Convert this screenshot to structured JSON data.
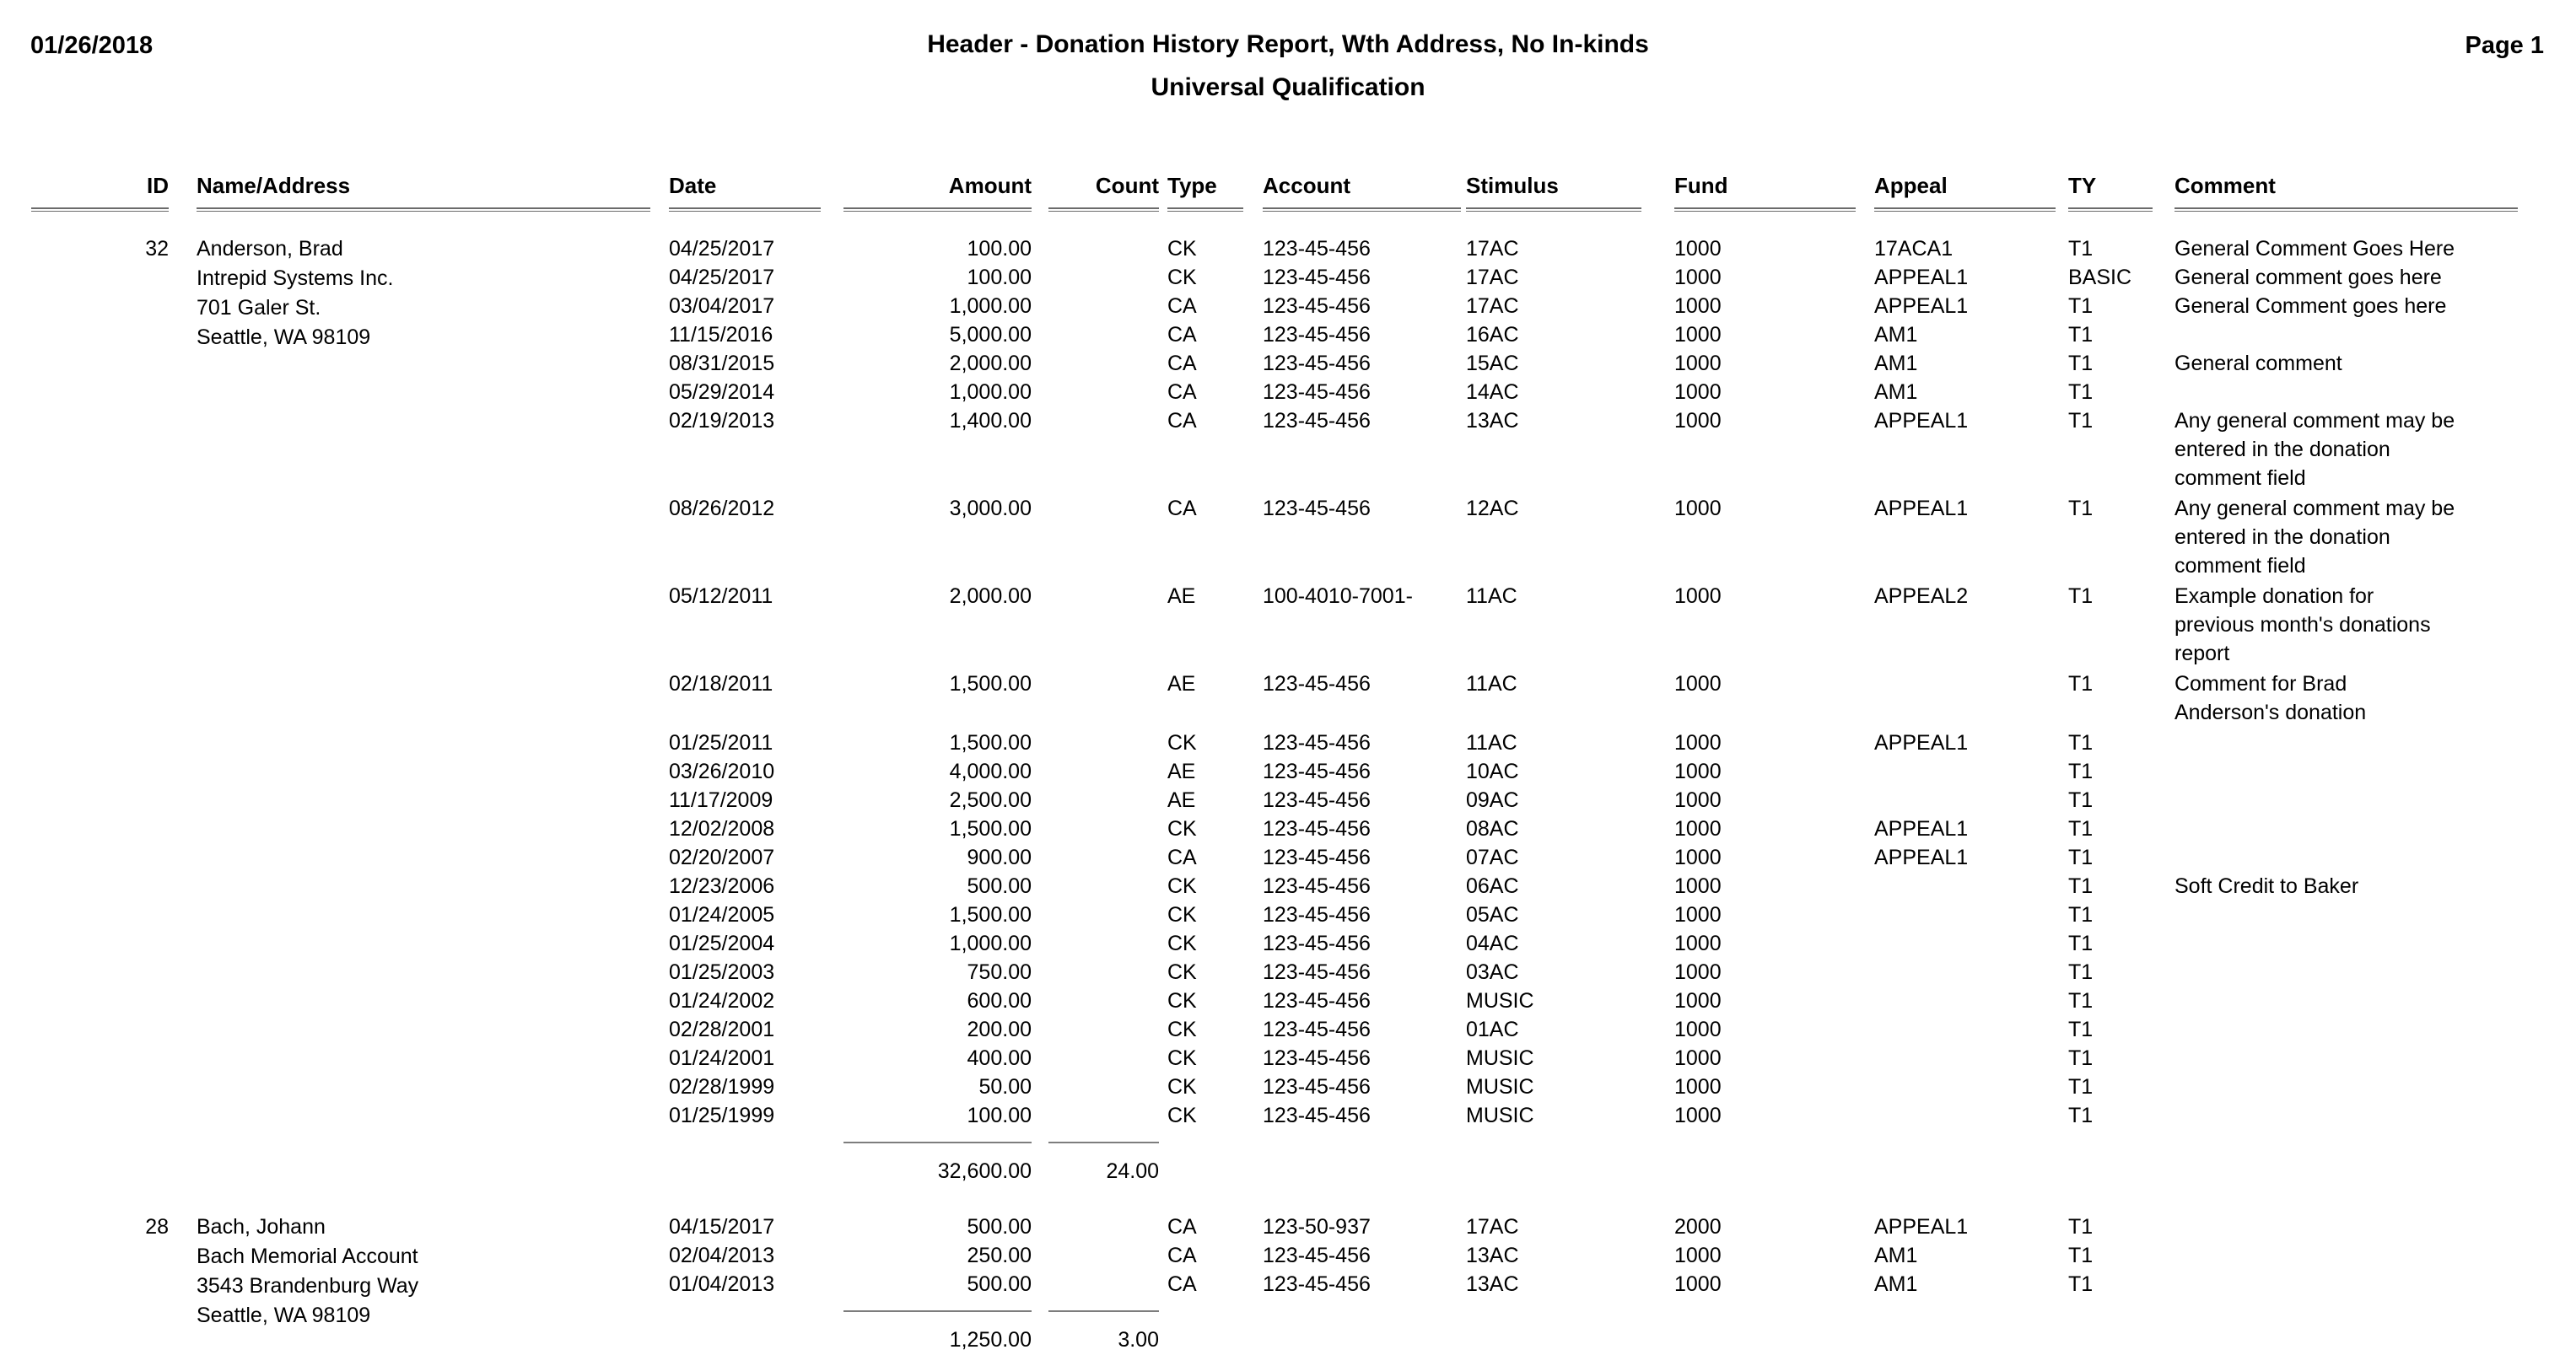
{
  "header": {
    "date": "01/26/2018",
    "title": "Header - Donation History Report, Wth Address, No In-kinds",
    "subtitle": "Universal Qualification",
    "page_label": "Page 1"
  },
  "columns": {
    "id": "ID",
    "name_address": "Name/Address",
    "date": "Date",
    "amount": "Amount",
    "count": "Count",
    "type": "Type",
    "account": "Account",
    "stimulus": "Stimulus",
    "fund": "Fund",
    "appeal": "Appeal",
    "ty": "TY",
    "comment": "Comment"
  },
  "records": [
    {
      "id": "32",
      "name_address": [
        "Anderson, Brad",
        "Intrepid Systems Inc.",
        "701 Galer St.",
        "Seattle, WA 98109"
      ],
      "donations": [
        {
          "date": "04/25/2017",
          "amount": "100.00",
          "type": "CK",
          "account": "123-45-456",
          "stimulus": "17AC",
          "fund": "1000",
          "appeal": "17ACA1",
          "ty": "T1",
          "comment": "General Comment Goes Here"
        },
        {
          "date": "04/25/2017",
          "amount": "100.00",
          "type": "CK",
          "account": "123-45-456",
          "stimulus": "17AC",
          "fund": "1000",
          "appeal": "APPEAL1",
          "ty": "BASIC",
          "comment": "General comment goes here"
        },
        {
          "date": "03/04/2017",
          "amount": "1,000.00",
          "type": "CA",
          "account": "123-45-456",
          "stimulus": "17AC",
          "fund": "1000",
          "appeal": "APPEAL1",
          "ty": "T1",
          "comment": "General Comment goes here"
        },
        {
          "date": "11/15/2016",
          "amount": "5,000.00",
          "type": "CA",
          "account": "123-45-456",
          "stimulus": "16AC",
          "fund": "1000",
          "appeal": "AM1",
          "ty": "T1",
          "comment": ""
        },
        {
          "date": "08/31/2015",
          "amount": "2,000.00",
          "type": "CA",
          "account": "123-45-456",
          "stimulus": "15AC",
          "fund": "1000",
          "appeal": "AM1",
          "ty": "T1",
          "comment": "General comment"
        },
        {
          "date": "05/29/2014",
          "amount": "1,000.00",
          "type": "CA",
          "account": "123-45-456",
          "stimulus": "14AC",
          "fund": "1000",
          "appeal": "AM1",
          "ty": "T1",
          "comment": ""
        },
        {
          "date": "02/19/2013",
          "amount": "1,400.00",
          "type": "CA",
          "account": "123-45-456",
          "stimulus": "13AC",
          "fund": "1000",
          "appeal": "APPEAL1",
          "ty": "T1",
          "comment": "Any general comment may be entered in the donation comment field"
        },
        {
          "date": "08/26/2012",
          "amount": "3,000.00",
          "type": "CA",
          "account": "123-45-456",
          "stimulus": "12AC",
          "fund": "1000",
          "appeal": "APPEAL1",
          "ty": "T1",
          "comment": "Any general comment may be entered in the donation comment field"
        },
        {
          "date": "05/12/2011",
          "amount": "2,000.00",
          "type": "AE",
          "account": "100-4010-7001-",
          "stimulus": "11AC",
          "fund": "1000",
          "appeal": "APPEAL2",
          "ty": "T1",
          "comment": "Example donation for previous month's donations report"
        },
        {
          "date": "02/18/2011",
          "amount": "1,500.00",
          "type": "AE",
          "account": "123-45-456",
          "stimulus": "11AC",
          "fund": "1000",
          "appeal": "",
          "ty": "T1",
          "comment": "Comment for Brad Anderson's donation"
        },
        {
          "date": "01/25/2011",
          "amount": "1,500.00",
          "type": "CK",
          "account": "123-45-456",
          "stimulus": "11AC",
          "fund": "1000",
          "appeal": "APPEAL1",
          "ty": "T1",
          "comment": ""
        },
        {
          "date": "03/26/2010",
          "amount": "4,000.00",
          "type": "AE",
          "account": "123-45-456",
          "stimulus": "10AC",
          "fund": "1000",
          "appeal": "",
          "ty": "T1",
          "comment": ""
        },
        {
          "date": "11/17/2009",
          "amount": "2,500.00",
          "type": "AE",
          "account": "123-45-456",
          "stimulus": "09AC",
          "fund": "1000",
          "appeal": "",
          "ty": "T1",
          "comment": ""
        },
        {
          "date": "12/02/2008",
          "amount": "1,500.00",
          "type": "CK",
          "account": "123-45-456",
          "stimulus": "08AC",
          "fund": "1000",
          "appeal": "APPEAL1",
          "ty": "T1",
          "comment": ""
        },
        {
          "date": "02/20/2007",
          "amount": "900.00",
          "type": "CA",
          "account": "123-45-456",
          "stimulus": "07AC",
          "fund": "1000",
          "appeal": "APPEAL1",
          "ty": "T1",
          "comment": ""
        },
        {
          "date": "12/23/2006",
          "amount": "500.00",
          "type": "CK",
          "account": "123-45-456",
          "stimulus": "06AC",
          "fund": "1000",
          "appeal": "",
          "ty": "T1",
          "comment": "Soft Credit to Baker"
        },
        {
          "date": "01/24/2005",
          "amount": "1,500.00",
          "type": "CK",
          "account": "123-45-456",
          "stimulus": "05AC",
          "fund": "1000",
          "appeal": "",
          "ty": "T1",
          "comment": ""
        },
        {
          "date": "01/25/2004",
          "amount": "1,000.00",
          "type": "CK",
          "account": "123-45-456",
          "stimulus": "04AC",
          "fund": "1000",
          "appeal": "",
          "ty": "T1",
          "comment": ""
        },
        {
          "date": "01/25/2003",
          "amount": "750.00",
          "type": "CK",
          "account": "123-45-456",
          "stimulus": "03AC",
          "fund": "1000",
          "appeal": "",
          "ty": "T1",
          "comment": ""
        },
        {
          "date": "01/24/2002",
          "amount": "600.00",
          "type": "CK",
          "account": "123-45-456",
          "stimulus": "MUSIC",
          "fund": "1000",
          "appeal": "",
          "ty": "T1",
          "comment": ""
        },
        {
          "date": "02/28/2001",
          "amount": "200.00",
          "type": "CK",
          "account": "123-45-456",
          "stimulus": "01AC",
          "fund": "1000",
          "appeal": "",
          "ty": "T1",
          "comment": ""
        },
        {
          "date": "01/24/2001",
          "amount": "400.00",
          "type": "CK",
          "account": "123-45-456",
          "stimulus": "MUSIC",
          "fund": "1000",
          "appeal": "",
          "ty": "T1",
          "comment": ""
        },
        {
          "date": "02/28/1999",
          "amount": "50.00",
          "type": "CK",
          "account": "123-45-456",
          "stimulus": "MUSIC",
          "fund": "1000",
          "appeal": "",
          "ty": "T1",
          "comment": ""
        },
        {
          "date": "01/25/1999",
          "amount": "100.00",
          "type": "CK",
          "account": "123-45-456",
          "stimulus": "MUSIC",
          "fund": "1000",
          "appeal": "",
          "ty": "T1",
          "comment": ""
        }
      ],
      "subtotal_amount": "32,600.00",
      "subtotal_count": "24.00"
    },
    {
      "id": "28",
      "name_address": [
        "Bach, Johann",
        "Bach Memorial Account",
        "3543 Brandenburg Way",
        "Seattle, WA 98109"
      ],
      "donations": [
        {
          "date": "04/15/2017",
          "amount": "500.00",
          "type": "CA",
          "account": "123-50-937",
          "stimulus": "17AC",
          "fund": "2000",
          "appeal": "APPEAL1",
          "ty": "T1",
          "comment": ""
        },
        {
          "date": "02/04/2013",
          "amount": "250.00",
          "type": "CA",
          "account": "123-45-456",
          "stimulus": "13AC",
          "fund": "1000",
          "appeal": "AM1",
          "ty": "T1",
          "comment": ""
        },
        {
          "date": "01/04/2013",
          "amount": "500.00",
          "type": "CA",
          "account": "123-45-456",
          "stimulus": "13AC",
          "fund": "1000",
          "appeal": "AM1",
          "ty": "T1",
          "comment": ""
        }
      ],
      "subtotal_amount": "1,250.00",
      "subtotal_count": "3.00"
    }
  ]
}
